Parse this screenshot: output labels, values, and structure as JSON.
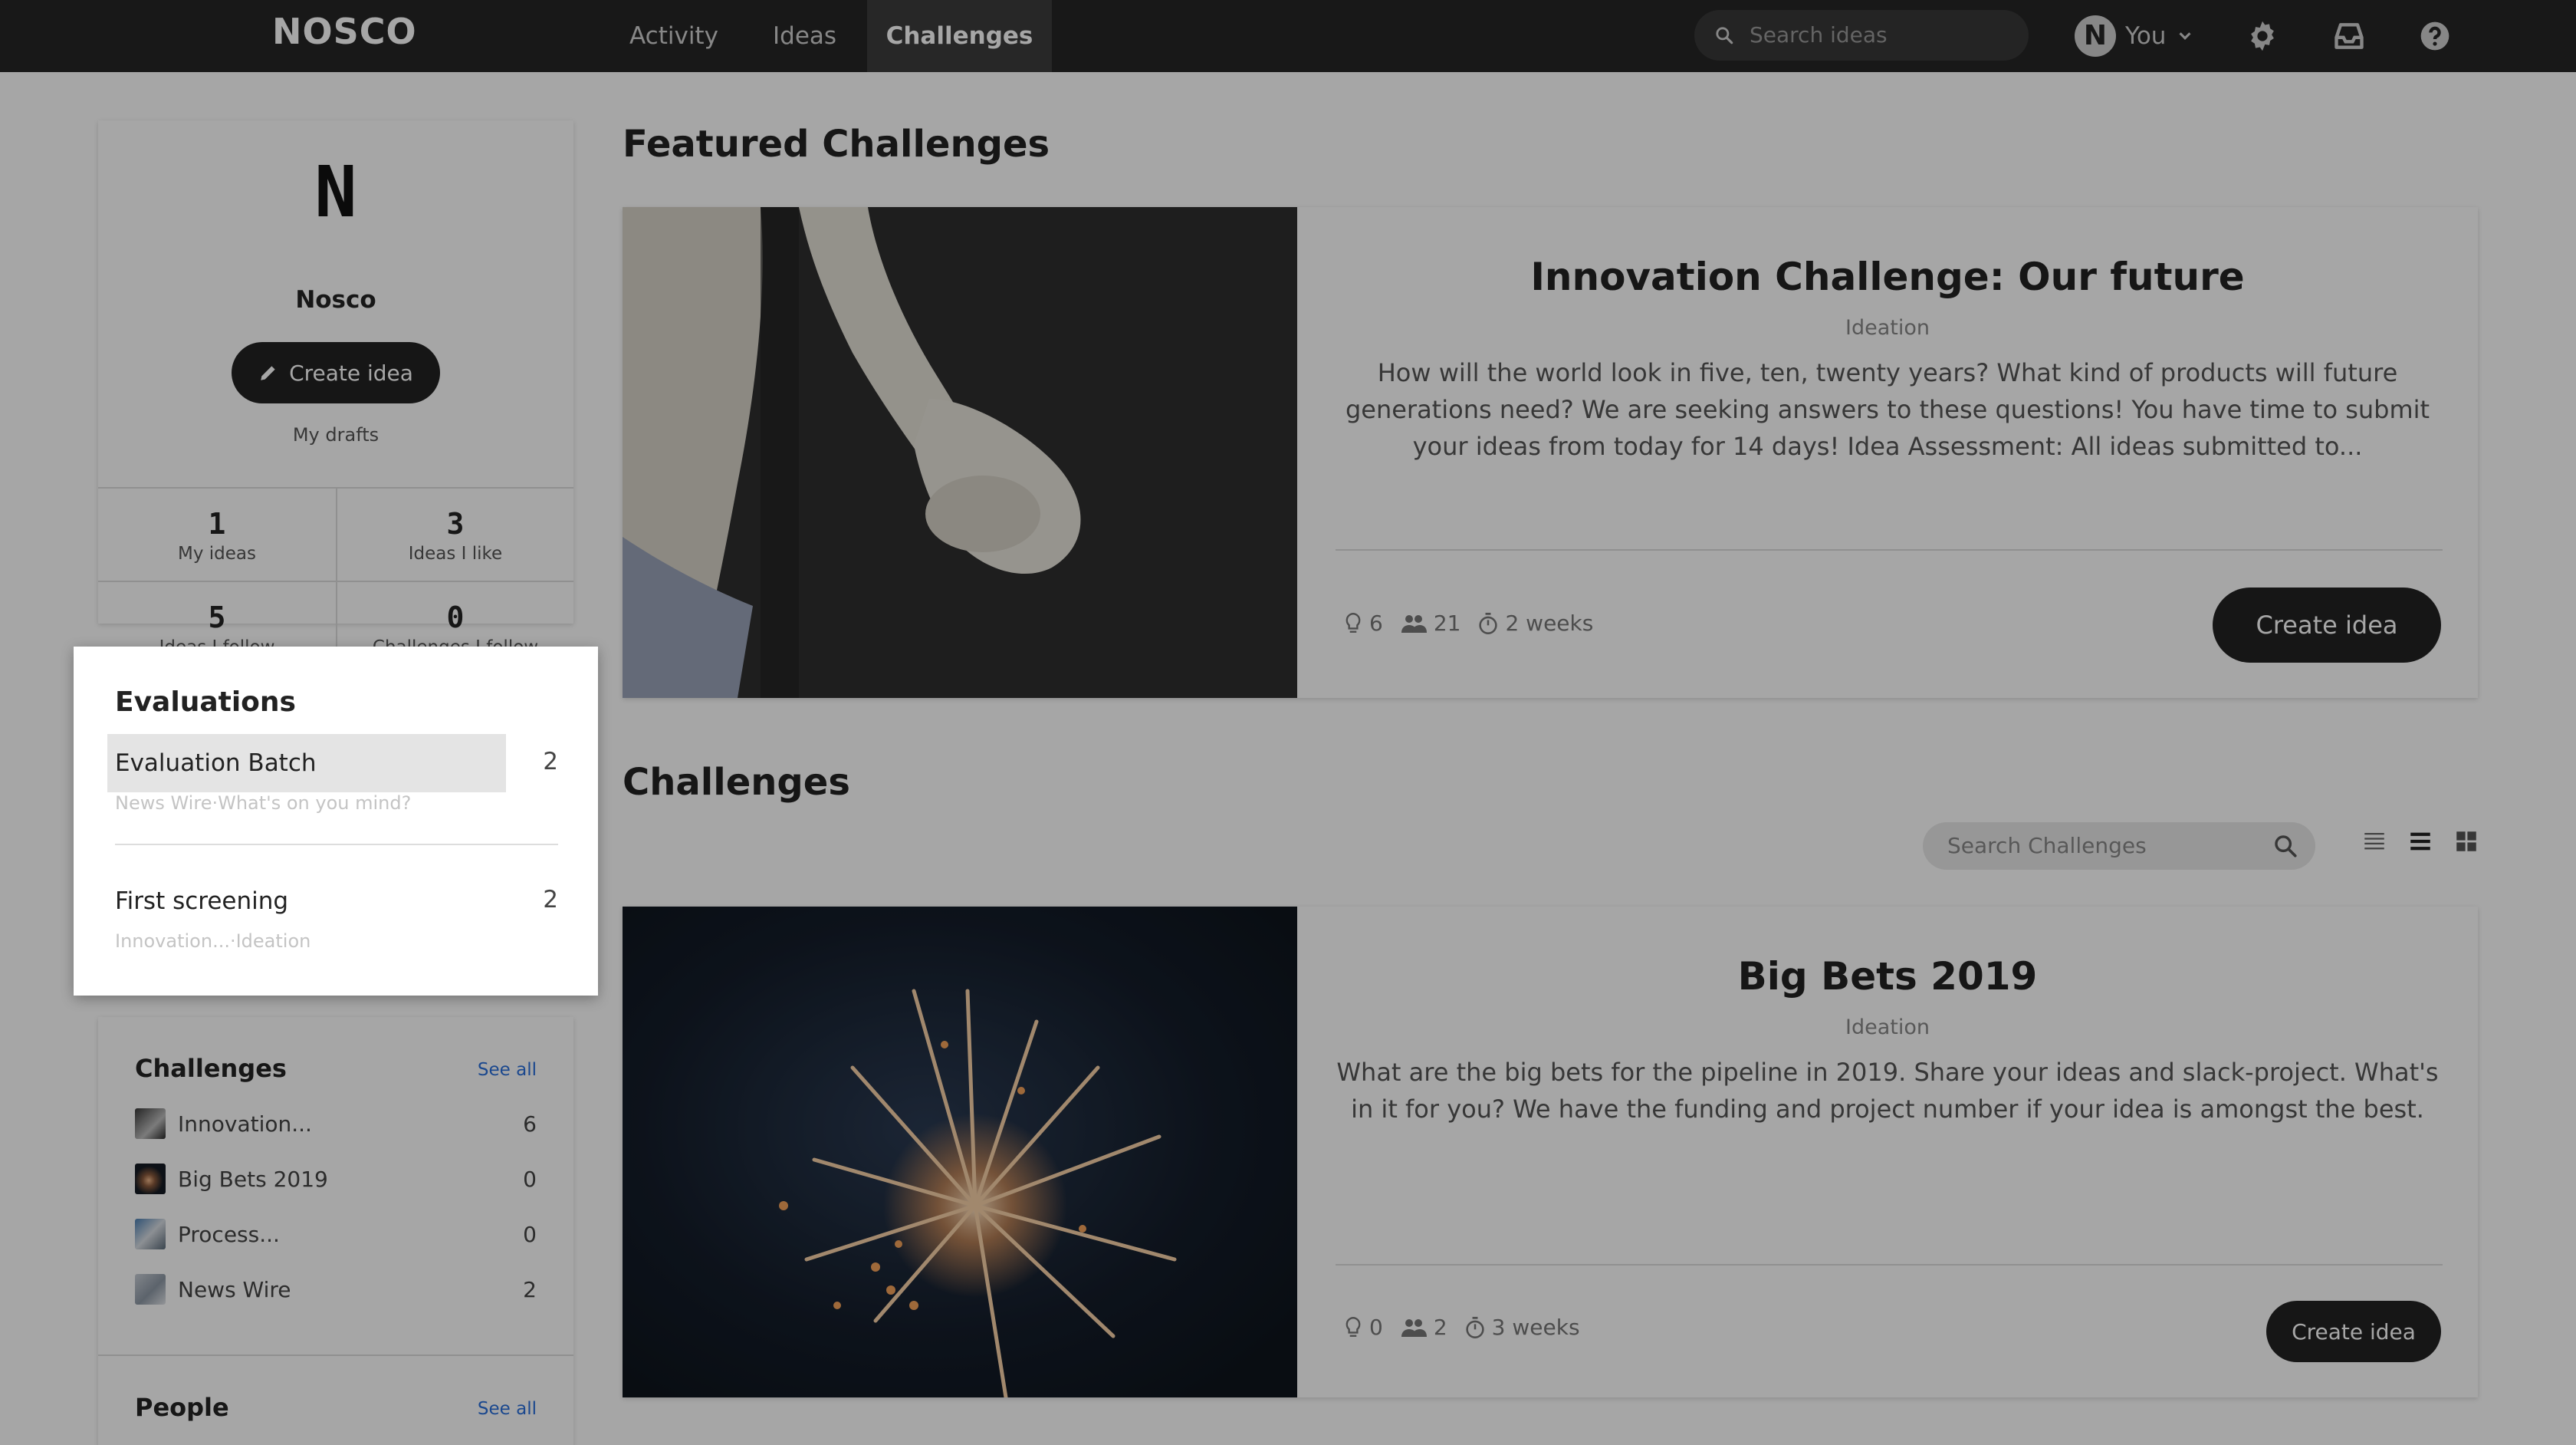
{
  "nav": {
    "brand": "NOSCO",
    "tabs": [
      {
        "label": "Activity"
      },
      {
        "label": "Ideas"
      },
      {
        "label": "Challenges"
      }
    ],
    "active_tab": "Challenges",
    "search_placeholder": "Search ideas",
    "user_label": "You",
    "user_logo": "N",
    "icons": [
      "search-icon",
      "chevron-down-icon",
      "gear-icon",
      "inbox-icon",
      "help-icon"
    ]
  },
  "profile": {
    "initial": "N",
    "name": "Nosco",
    "create_label": "Create idea",
    "drafts_label": "My drafts",
    "stats": [
      {
        "num": "1",
        "label": "My ideas"
      },
      {
        "num": "3",
        "label": "Ideas I like"
      },
      {
        "num": "5",
        "label": "Ideas I follow"
      },
      {
        "num": "0",
        "label": "Challenges I follow"
      }
    ]
  },
  "evaluations": {
    "title": "Evaluations",
    "items": [
      {
        "label": "Evaluation Batch",
        "count": "2",
        "sub": "News Wire·What's on you mind?"
      },
      {
        "label": "First screening",
        "count": "2",
        "sub": "Innovation...·Ideation"
      }
    ]
  },
  "side_challenges": {
    "title": "Challenges",
    "see_all": "See all",
    "items": [
      {
        "label": "Innovation...",
        "count": "6"
      },
      {
        "label": "Big Bets 2019",
        "count": "0"
      },
      {
        "label": "Process...",
        "count": "0"
      },
      {
        "label": "News Wire",
        "count": "2"
      }
    ]
  },
  "people": {
    "title": "People",
    "see_all": "See all"
  },
  "featured": {
    "heading": "Featured Challenges",
    "title": "Innovation Challenge: Our future",
    "type": "Ideation",
    "description": "How will the world look in five, ten, twenty years? What kind of products will future generations need? We are seeking answers to these questions! You have time to submit your ideas from today for 14 days! Idea Assessment: All ideas submitted to...",
    "ideas": "6",
    "participants": "21",
    "time": "2 weeks",
    "create_label": "Create idea"
  },
  "challenges": {
    "heading": "Challenges",
    "search_placeholder": "Search Challenges",
    "view_icons": [
      "compact-list-icon",
      "list-icon",
      "grid-icon"
    ],
    "items": [
      {
        "title": "Big Bets 2019",
        "type": "Ideation",
        "description": "What are the big bets for the pipeline in 2019. Share your ideas and slack-project. What's in it for you? We have the funding and project number if your idea is amongst the best.",
        "ideas": "0",
        "participants": "2",
        "time": "3 weeks",
        "create_label": "Create idea"
      }
    ]
  },
  "colors": {
    "nav_bg": "#262626",
    "overlay": "rgba(0,0,0,0.35)",
    "button_bg": "#222222",
    "link": "#2a6fdb"
  }
}
